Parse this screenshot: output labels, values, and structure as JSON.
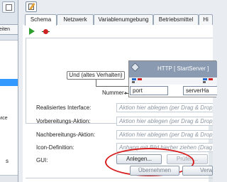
{
  "left_panel": {
    "tab_partial": "Arbeiten",
    "fragment_service": "ervice",
    "fragment_bottom": "s"
  },
  "tabs": [
    {
      "label": "Schema",
      "active": true
    },
    {
      "label": "Netzwerk",
      "active": false
    },
    {
      "label": "Variablenumgebung",
      "active": false
    },
    {
      "label": "Betriebsmittel",
      "active": false
    },
    {
      "label": "Hi",
      "active": false
    }
  ],
  "toolbar": {
    "run_icon": "play-icon",
    "debug_icon": "bug-icon"
  },
  "canvas": {
    "zone_label": "Und (altes Verhalten)",
    "input_label": "Nummer",
    "node": {
      "title": "HTTP [ StartServer ]",
      "cells": [
        "port",
        "serverHa"
      ]
    }
  },
  "form": {
    "rows": [
      {
        "label": "Realisiertes Interface:",
        "placeholder": "Aktion hier ablegen (per Drag & Drop)"
      },
      {
        "label": "Vorbereitungs-Aktion:",
        "placeholder": "Aktion hier ablegen (per Drag & Drop)"
      },
      {
        "label": "Nachbereitungs-Aktion:",
        "placeholder": "Aktion hier ablegen (per Drag & Drop)"
      },
      {
        "label": "Icon-Definition:",
        "placeholder": "Anhang mit Bild hierher ziehen (Drag & D"
      }
    ],
    "gui_label": "GUI:",
    "anlegen_button": "Anlegen...",
    "pruefen_button": "Prüfen...",
    "uebernehmen_button": "Übernehmen",
    "verwerfen_button": "Verw"
  },
  "colors": {
    "highlight_circle": "#d81f1f",
    "node_header": "#8a9ab0",
    "selection": "#3399ff"
  }
}
